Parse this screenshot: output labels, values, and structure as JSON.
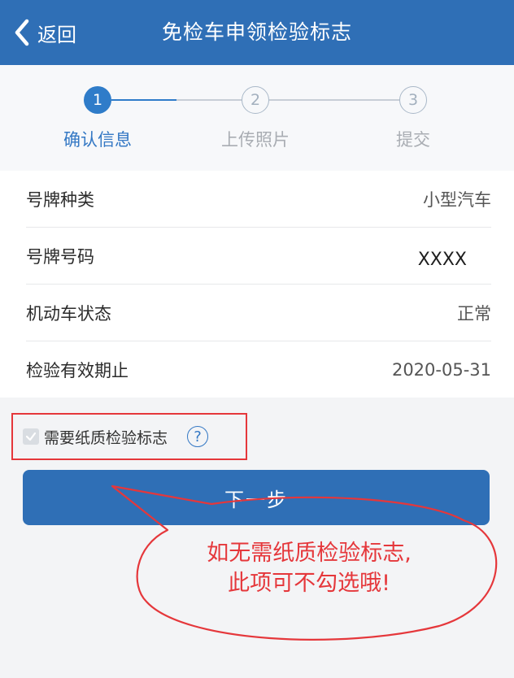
{
  "header": {
    "back_label": "返回",
    "title": "免检车申领检验标志"
  },
  "steps": [
    {
      "number": "1",
      "label": "确认信息",
      "state": "active"
    },
    {
      "number": "2",
      "label": "上传照片",
      "state": "idle"
    },
    {
      "number": "3",
      "label": "提交",
      "state": "idle"
    }
  ],
  "info_rows": [
    {
      "label": "号牌种类",
      "value": "小型汽车"
    },
    {
      "label": "号牌号码",
      "value": "XXXX"
    },
    {
      "label": "机动车状态",
      "value": "正常"
    },
    {
      "label": "检验有效期止",
      "value": "2020-05-31"
    }
  ],
  "paper_option": {
    "label": "需要纸质检验标志",
    "checked": true,
    "help_symbol": "?"
  },
  "next_button": "下一步",
  "annotation": {
    "line1": "如无需纸质检验标志,",
    "line2": "此项可不勾选哦!"
  },
  "colors": {
    "primary": "#2f6fb6",
    "step_active": "#2f7cc9",
    "annotation_red": "#e5373b"
  },
  "icons": {
    "back": "chevron-left-icon",
    "check": "check-icon",
    "help": "question-circle-icon"
  }
}
